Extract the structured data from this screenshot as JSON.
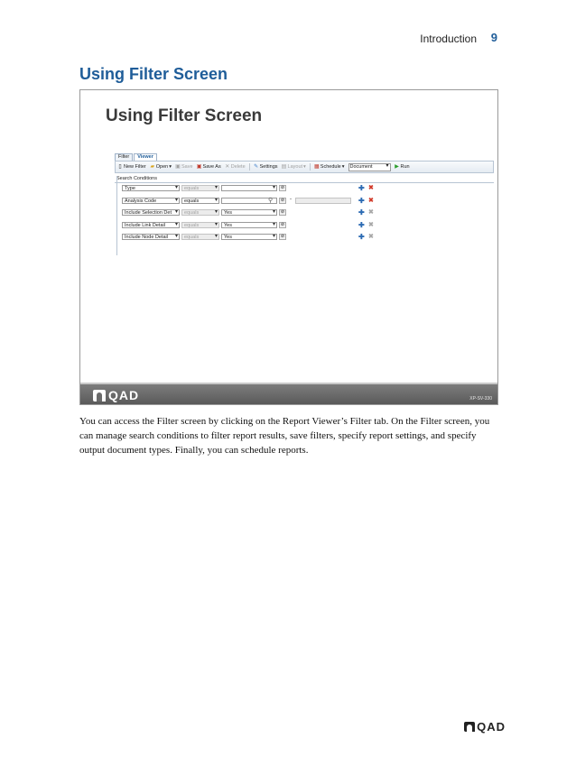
{
  "header": {
    "section": "Introduction",
    "page_number": "9"
  },
  "page_heading": "Using Filter Screen",
  "slide": {
    "title": "Using Filter Screen",
    "logo_text": "QAD",
    "code": "XP-SV-330",
    "app": {
      "tabs": [
        {
          "label": "Filter"
        },
        {
          "label": "Viewer"
        }
      ],
      "toolbar": {
        "new_filter": "New Filter",
        "open": "Open",
        "save": "Save",
        "save_as": "Save As",
        "delete": "Delete",
        "settings": "Settings",
        "layout": "Layout",
        "schedule": "Schedule",
        "output_type": "Document",
        "run": "Run"
      },
      "search_conditions_title": "Search Conditions",
      "conditions": [
        {
          "field": "Type",
          "operator": "equals",
          "value": ""
        },
        {
          "field": "Analysis Code",
          "operator": "equals",
          "value": "",
          "range_to": ""
        },
        {
          "field": "Include Selection Det",
          "operator": "equals",
          "value": "Yes"
        },
        {
          "field": "Include Link Detail",
          "operator": "equals",
          "value": "Yes"
        },
        {
          "field": "Include Node Detail",
          "operator": "equals",
          "value": "Yes"
        }
      ]
    }
  },
  "body_text": "You can access the Filter screen by clicking on the Report Viewer’s Filter tab. On the Filter screen, you can manage search conditions to filter report results, save filters, specify report settings, and specify output document types. Finally, you can schedule reports.",
  "footer": {
    "logo_text": "QAD"
  },
  "colors": {
    "heading_blue": "#1f5d99",
    "footer_bar": "#6b6b6b",
    "delete_red": "#d23a2a",
    "add_blue": "#2c6bb3"
  }
}
